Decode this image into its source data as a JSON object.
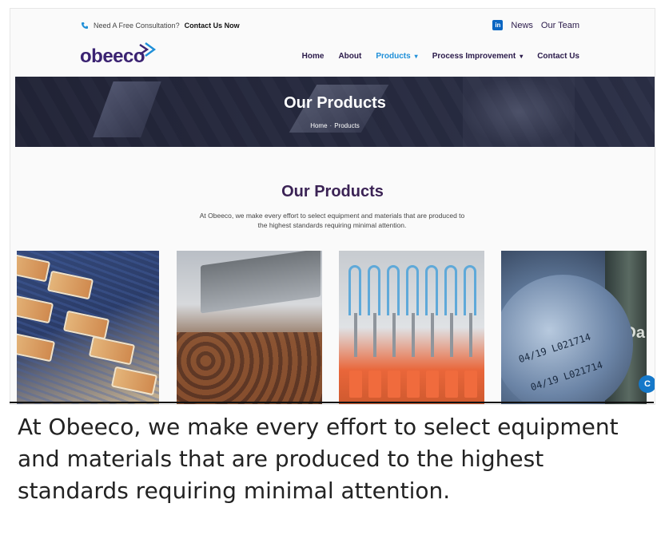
{
  "topbar": {
    "consult_text": "Need A Free Consultation?",
    "consult_link": "Contact Us Now",
    "linkedin_icon": "linkedin-icon",
    "links": [
      "News",
      "Our Team"
    ]
  },
  "nav": {
    "logo": "obeeco",
    "items": [
      {
        "label": "Home"
      },
      {
        "label": "About"
      },
      {
        "label": "Products",
        "dropdown": true,
        "active": true
      },
      {
        "label": "Process Improvement",
        "dropdown": true
      },
      {
        "label": "Contact Us"
      }
    ]
  },
  "hero": {
    "title": "Our Products",
    "breadcrumb": [
      "Home",
      "Products"
    ],
    "breadcrumb_sep": "·"
  },
  "intro": {
    "heading": "Our Products",
    "text": "At Obeeco, we make every effort to select equipment and materials that are produced to the highest standards requiring minimal attention."
  },
  "products": [
    {
      "image": "packaged-food-conveyor"
    },
    {
      "image": "grilled-meat-oven"
    },
    {
      "image": "filling-machine-nozzles"
    },
    {
      "image": "can-date-coding",
      "code_line_1": "04/19 L021714",
      "code_line_2": "04/19 L021714",
      "bottle_text": "Da"
    }
  ],
  "chat": {
    "icon": "chat-icon",
    "glyph": "C"
  },
  "caption": "At Obeeco, we make every effort to select equipment and materials that are produced to the highest standards requiring minimal attention.",
  "colors": {
    "brand": "#3b2372",
    "accent": "#1e8fd8",
    "heading": "#3b2355"
  }
}
